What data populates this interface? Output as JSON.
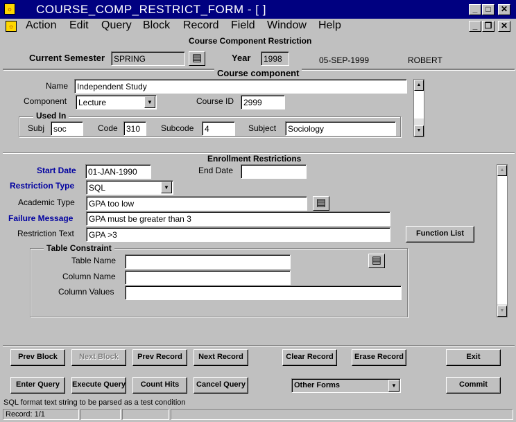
{
  "window": {
    "title": "COURSE_COMP_RESTRICT_FORM - [ ]",
    "form_title": "Course Component Restriction"
  },
  "menu": [
    "Action",
    "Edit",
    "Query",
    "Block",
    "Record",
    "Field",
    "Window",
    "Help"
  ],
  "header": {
    "semester_label": "Current Semester",
    "semester_value": "SPRING",
    "year_label": "Year",
    "year_value": "1998",
    "date": "05-SEP-1999",
    "user": "ROBERT"
  },
  "course_component": {
    "section_title": "Course component",
    "name_label": "Name",
    "name_value": "Independent Study",
    "component_label": "Component",
    "component_value": "Lecture",
    "course_id_label": "Course ID",
    "course_id_value": "2999",
    "used_in_title": "Used In",
    "subj_label": "Subj",
    "subj_value": "soc",
    "code_label": "Code",
    "code_value": "310",
    "subcode_label": "Subcode",
    "subcode_value": "4",
    "subject_label": "Subject",
    "subject_value": "Sociology"
  },
  "enrollment": {
    "section_title": "Enrollment Restrictions",
    "start_date_label": "Start Date",
    "start_date_value": "01-JAN-1990",
    "end_date_label": "End Date",
    "end_date_value": "",
    "restriction_type_label": "Restriction Type",
    "restriction_type_value": "SQL",
    "academic_type_label": "Academic Type",
    "academic_type_value": "GPA too low",
    "failure_message_label": "Failure Message",
    "failure_message_value": "GPA must be greater than 3",
    "restriction_text_label": "Restriction Text",
    "restriction_text_value": "GPA >3",
    "function_list_button": "Function List",
    "table_constraint_title": "Table Constraint",
    "table_name_label": "Table Name",
    "table_name_value": "",
    "column_name_label": "Column Name",
    "column_name_value": "",
    "column_values_label": "Column Values",
    "column_values_value": ""
  },
  "buttons": {
    "prev_block": "Prev Block",
    "next_block": "Next Block",
    "prev_record": "Prev Record",
    "next_record": "Next Record",
    "clear_record": "Clear Record",
    "erase_record": "Erase Record",
    "exit": "Exit",
    "enter_query": "Enter Query",
    "execute_query": "Execute Query",
    "count_hits": "Count Hits",
    "cancel_query": "Cancel Query",
    "other_forms": "Other Forms",
    "commit": "Commit"
  },
  "status": {
    "hint": "SQL format text string to be parsed as a test condition",
    "record": "Record: 1/1"
  },
  "icons": {
    "lov": "list-of-values-icon",
    "dropdown": "chevron-down-icon",
    "scroll_up": "scroll-up-icon",
    "scroll_down": "scroll-down-icon"
  },
  "colors": {
    "titlebar": "#000080",
    "required_label": "#0000a0",
    "background": "#c0c0c0"
  }
}
